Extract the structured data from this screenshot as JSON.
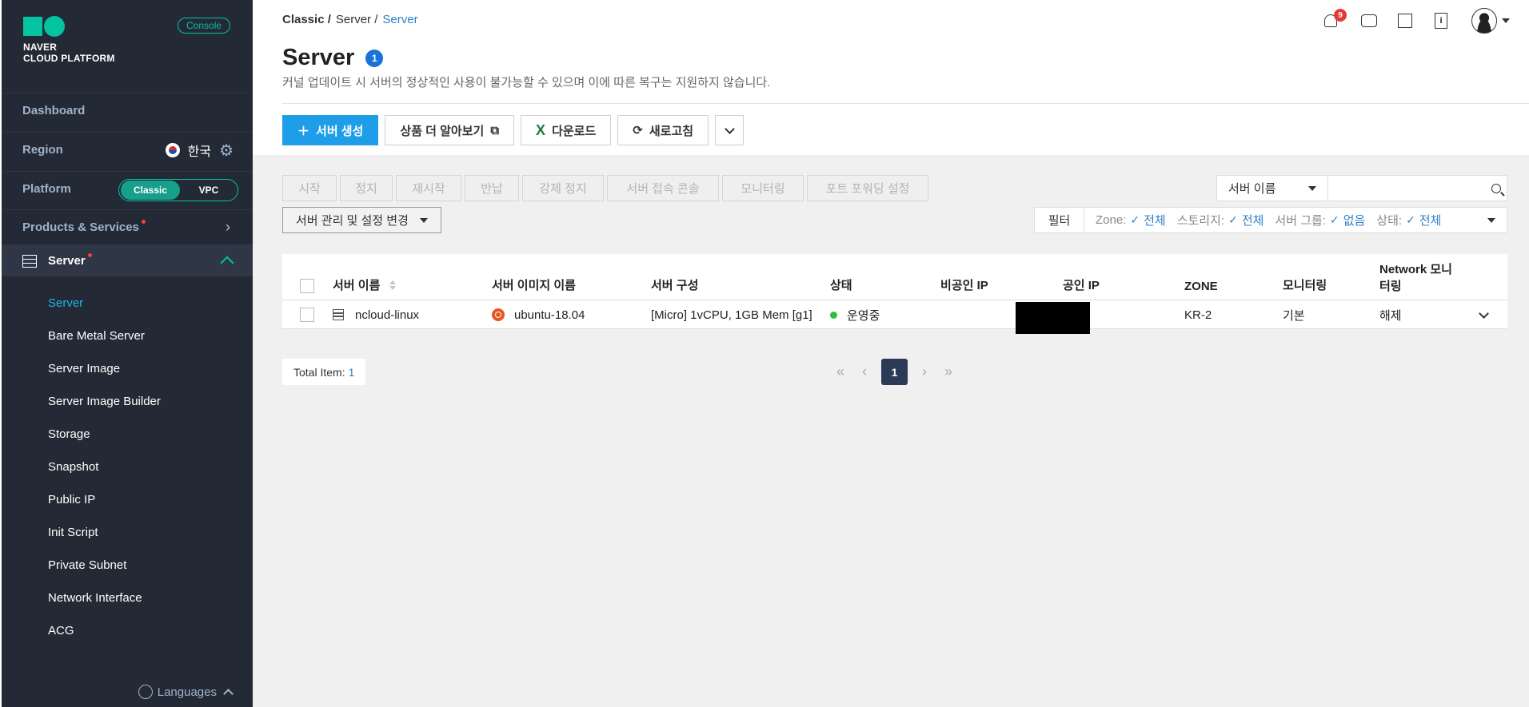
{
  "sidebar": {
    "logo_line1": "NAVER",
    "logo_line2": "CLOUD PLATFORM",
    "console_badge": "Console",
    "dashboard": "Dashboard",
    "region_label": "Region",
    "region_value": "한국",
    "platform_label": "Platform",
    "platform_classic": "Classic",
    "platform_vpc": "VPC",
    "products_services": "Products & Services",
    "server_section": "Server",
    "sub_items": [
      "Server",
      "Bare Metal Server",
      "Server Image",
      "Server Image Builder",
      "Storage",
      "Snapshot",
      "Public IP",
      "Init Script",
      "Private Subnet",
      "Network Interface",
      "ACG"
    ],
    "languages": "Languages"
  },
  "header": {
    "breadcrumb": [
      "Classic /",
      "Server /",
      "Server"
    ],
    "title": "Server",
    "title_badge": "1",
    "description": "커널 업데이트 시 서버의 정상적인 사용이 불가능할 수 있으며 이에 따른 복구는 지원하지 않습니다.",
    "notification_count": "9"
  },
  "toolbar": {
    "create_server": "서버 생성",
    "learn_more": "상품 더 알아보기",
    "download": "다운로드",
    "refresh": "새로고침"
  },
  "actions": {
    "buttons": [
      "시작",
      "정지",
      "재시작",
      "반납",
      "강제 정지",
      "서버 접속 콘솔",
      "모니터링",
      "포트 포워딩 설정"
    ],
    "manage": "서버 관리 및 설정 변경"
  },
  "search": {
    "select_value": "서버 이름",
    "input_value": "",
    "placeholder": ""
  },
  "filter": {
    "label": "필터",
    "zone_label": "Zone:",
    "zone_value": "전체",
    "storage_label": "스토리지:",
    "storage_value": "전체",
    "group_label": "서버 그룹:",
    "group_value": "없음",
    "status_label": "상태:",
    "status_value": "전체"
  },
  "table": {
    "headers": {
      "name": "서버 이름",
      "image": "서버 이미지 이름",
      "spec": "서버 구성",
      "status": "상태",
      "private_ip": "비공인 IP",
      "public_ip": "공인 IP",
      "zone": "ZONE",
      "monitoring": "모니터링",
      "network_line1": "Network 모니",
      "network_line2": "터링"
    },
    "rows": [
      {
        "name": "ncloud-linux",
        "image": "ubuntu-18.04",
        "spec": "[Micro] 1vCPU, 1GB Mem [g1]",
        "status": "운영중",
        "private_ip": "",
        "public_ip": "",
        "zone": "KR-2",
        "monitoring": "기본",
        "network_monitoring": "해제"
      }
    ]
  },
  "footer": {
    "total_label": "Total Item:",
    "total_value": "1",
    "current_page": "1"
  },
  "colors": {
    "sidebar_bg": "#232a35",
    "accent_teal": "#03c3a0",
    "primary_blue": "#1e9de8",
    "link_blue": "#2f80c8",
    "status_green": "#2bbf45"
  }
}
